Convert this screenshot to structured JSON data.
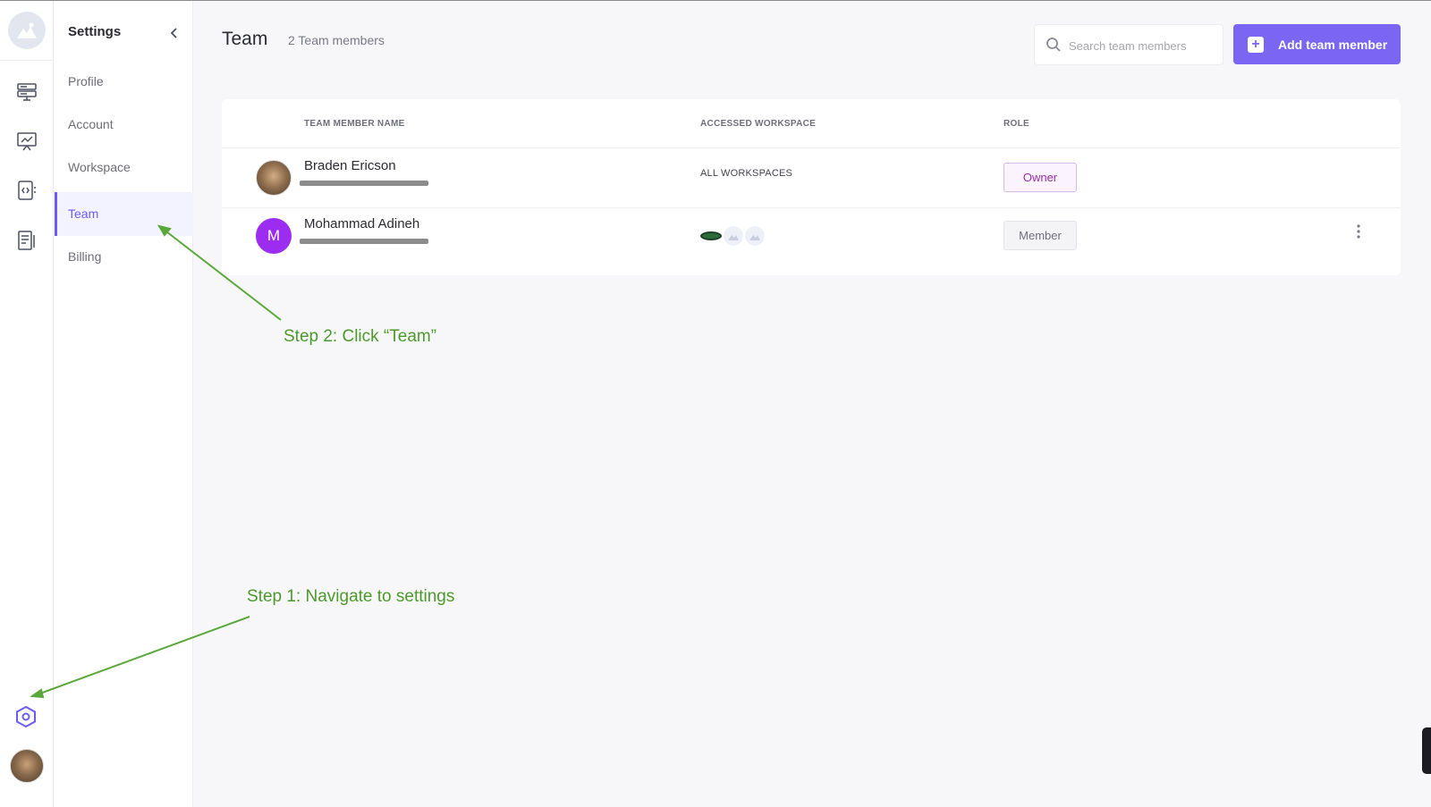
{
  "sidebar": {
    "title": "Settings",
    "items": [
      {
        "label": "Profile",
        "active": false
      },
      {
        "label": "Account",
        "active": false
      },
      {
        "label": "Workspace",
        "active": false
      },
      {
        "label": "Team",
        "active": true
      },
      {
        "label": "Billing",
        "active": false
      }
    ]
  },
  "rail": {
    "icons": [
      "logo-icon",
      "server-icon",
      "presentation-chart-icon",
      "code-file-icon",
      "document-icon",
      "settings-hexagon-icon",
      "user-avatar"
    ]
  },
  "header": {
    "title": "Team",
    "member_count": "2 Team members",
    "search_placeholder": "Search team members",
    "add_button_label": "Add team member"
  },
  "table": {
    "columns": [
      "TEAM MEMBER NAME",
      "ACCESSED WORKSPACE",
      "ROLE"
    ],
    "rows": [
      {
        "name": "Braden Ericson",
        "avatar_letter": "",
        "workspace": "ALL WORKSPACES",
        "role": "Owner"
      },
      {
        "name": "Mohammad Adineh",
        "avatar_letter": "M",
        "workspace": "",
        "role": "Member"
      }
    ]
  },
  "annotations": {
    "step2": "Step 2: Click “Team”",
    "step1": "Step 1: Navigate to settings"
  },
  "colors": {
    "accent": "#7a66f2",
    "annotation": "#4c9a2a",
    "owner_role": "#9a2ea8",
    "avatar_m": "#9b2cf0"
  }
}
